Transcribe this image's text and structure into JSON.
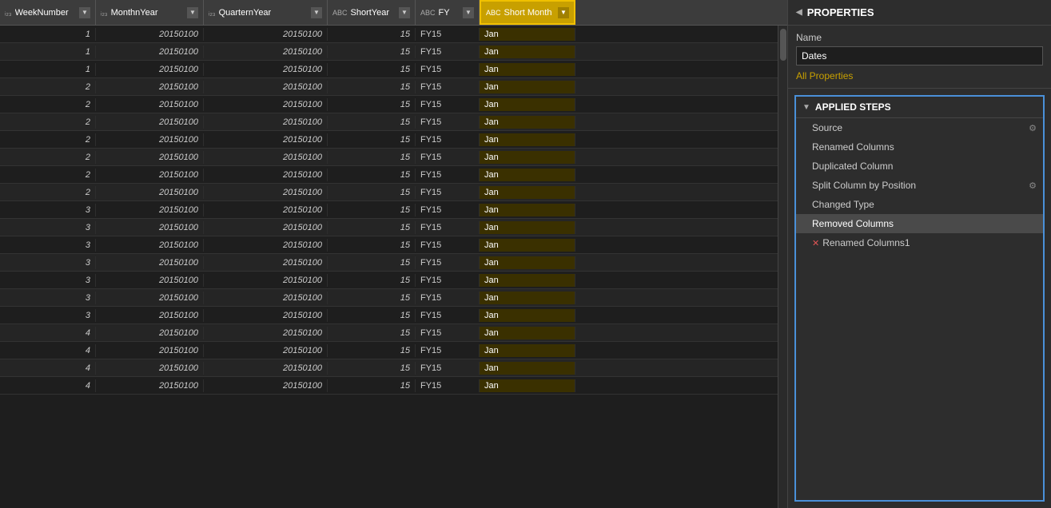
{
  "columns": [
    {
      "id": "week-number",
      "label": "WeekNumber",
      "type": "123",
      "width": "w-week"
    },
    {
      "id": "month-year",
      "label": "MonthnYear",
      "type": "123",
      "width": "w-month"
    },
    {
      "id": "quarter-year",
      "label": "QuarternYear",
      "type": "123",
      "width": "w-quarter"
    },
    {
      "id": "short-year",
      "label": "ShortYear",
      "type": "ABC",
      "width": "w-short"
    },
    {
      "id": "fy",
      "label": "FY",
      "type": "ABC",
      "width": "w-fy"
    },
    {
      "id": "short-month",
      "label": "Short Month",
      "type": "ABC",
      "width": "w-sm",
      "highlighted": true
    }
  ],
  "rows": [
    {
      "week": 1,
      "month": "20150100",
      "quarter": "20150100",
      "shortYear": 15,
      "fy": "FY15",
      "shortMonth": "Jan"
    },
    {
      "week": 1,
      "month": "20150100",
      "quarter": "20150100",
      "shortYear": 15,
      "fy": "FY15",
      "shortMonth": "Jan"
    },
    {
      "week": 1,
      "month": "20150100",
      "quarter": "20150100",
      "shortYear": 15,
      "fy": "FY15",
      "shortMonth": "Jan"
    },
    {
      "week": 2,
      "month": "20150100",
      "quarter": "20150100",
      "shortYear": 15,
      "fy": "FY15",
      "shortMonth": "Jan"
    },
    {
      "week": 2,
      "month": "20150100",
      "quarter": "20150100",
      "shortYear": 15,
      "fy": "FY15",
      "shortMonth": "Jan"
    },
    {
      "week": 2,
      "month": "20150100",
      "quarter": "20150100",
      "shortYear": 15,
      "fy": "FY15",
      "shortMonth": "Jan"
    },
    {
      "week": 2,
      "month": "20150100",
      "quarter": "20150100",
      "shortYear": 15,
      "fy": "FY15",
      "shortMonth": "Jan"
    },
    {
      "week": 2,
      "month": "20150100",
      "quarter": "20150100",
      "shortYear": 15,
      "fy": "FY15",
      "shortMonth": "Jan"
    },
    {
      "week": 2,
      "month": "20150100",
      "quarter": "20150100",
      "shortYear": 15,
      "fy": "FY15",
      "shortMonth": "Jan"
    },
    {
      "week": 2,
      "month": "20150100",
      "quarter": "20150100",
      "shortYear": 15,
      "fy": "FY15",
      "shortMonth": "Jan"
    },
    {
      "week": 3,
      "month": "20150100",
      "quarter": "20150100",
      "shortYear": 15,
      "fy": "FY15",
      "shortMonth": "Jan"
    },
    {
      "week": 3,
      "month": "20150100",
      "quarter": "20150100",
      "shortYear": 15,
      "fy": "FY15",
      "shortMonth": "Jan"
    },
    {
      "week": 3,
      "month": "20150100",
      "quarter": "20150100",
      "shortYear": 15,
      "fy": "FY15",
      "shortMonth": "Jan"
    },
    {
      "week": 3,
      "month": "20150100",
      "quarter": "20150100",
      "shortYear": 15,
      "fy": "FY15",
      "shortMonth": "Jan"
    },
    {
      "week": 3,
      "month": "20150100",
      "quarter": "20150100",
      "shortYear": 15,
      "fy": "FY15",
      "shortMonth": "Jan"
    },
    {
      "week": 3,
      "month": "20150100",
      "quarter": "20150100",
      "shortYear": 15,
      "fy": "FY15",
      "shortMonth": "Jan"
    },
    {
      "week": 3,
      "month": "20150100",
      "quarter": "20150100",
      "shortYear": 15,
      "fy": "FY15",
      "shortMonth": "Jan"
    },
    {
      "week": 4,
      "month": "20150100",
      "quarter": "20150100",
      "shortYear": 15,
      "fy": "FY15",
      "shortMonth": "Jan"
    },
    {
      "week": 4,
      "month": "20150100",
      "quarter": "20150100",
      "shortYear": 15,
      "fy": "FY15",
      "shortMonth": "Jan"
    },
    {
      "week": 4,
      "month": "20150100",
      "quarter": "20150100",
      "shortYear": 15,
      "fy": "FY15",
      "shortMonth": "Jan"
    },
    {
      "week": 4,
      "month": "20150100",
      "quarter": "20150100",
      "shortYear": 15,
      "fy": "FY15",
      "shortMonth": "Jan"
    }
  ],
  "rightPanel": {
    "propertiesTitle": "PROPERTIES",
    "nameLabel": "Name",
    "nameValue": "Dates",
    "allPropertiesLabel": "All Properties",
    "appliedStepsTitle": "APPLIED STEPS",
    "steps": [
      {
        "id": "source",
        "label": "Source",
        "hasGear": true,
        "hasError": false
      },
      {
        "id": "renamed-columns",
        "label": "Renamed Columns",
        "hasGear": false,
        "hasError": false
      },
      {
        "id": "duplicated-column",
        "label": "Duplicated Column",
        "hasGear": false,
        "hasError": false
      },
      {
        "id": "split-column-by-position",
        "label": "Split Column by Position",
        "hasGear": true,
        "hasError": false
      },
      {
        "id": "changed-type",
        "label": "Changed Type",
        "hasGear": false,
        "hasError": false
      },
      {
        "id": "removed-columns",
        "label": "Removed Columns",
        "hasGear": false,
        "hasError": false,
        "active": true
      },
      {
        "id": "renamed-columns-1",
        "label": "Renamed Columns1",
        "hasGear": false,
        "hasError": true
      }
    ]
  }
}
